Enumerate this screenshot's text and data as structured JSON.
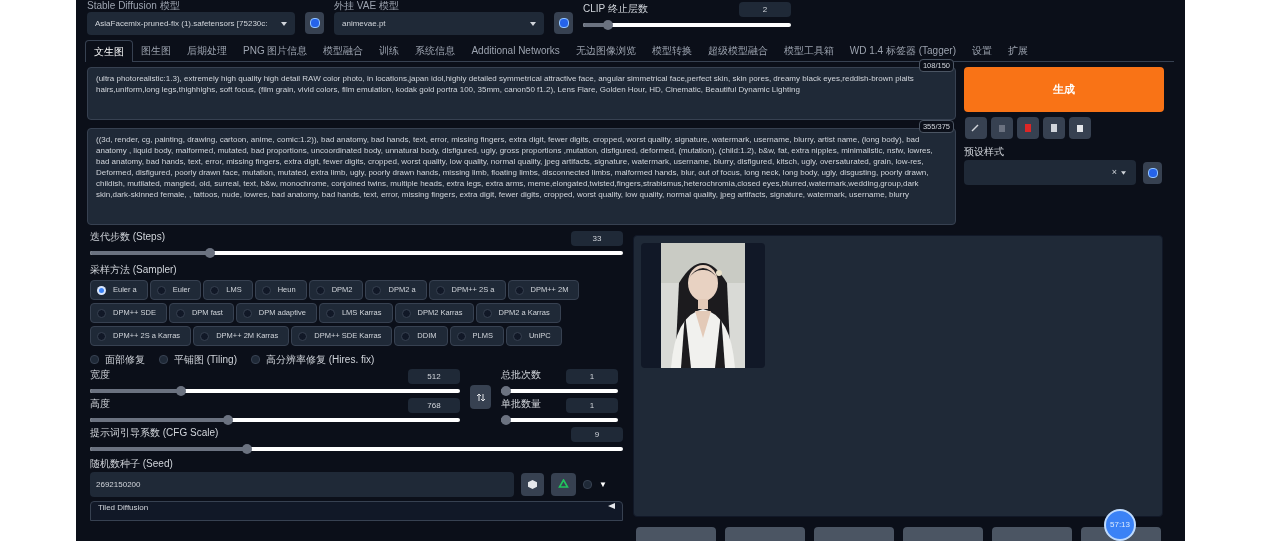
{
  "top_bar": {
    "model": {
      "label": "Stable Diffusion 模型",
      "value": "AsiaFacemix-pruned-fix (1).safetensors [75230c:"
    },
    "vae": {
      "label": "外挂 VAE 模型",
      "value": "animevae.pt"
    },
    "clip": {
      "label": "CLIP 终止层数",
      "value": "2",
      "level": 0.1
    }
  },
  "tabs": [
    {
      "label": "文生图",
      "selected": true
    },
    {
      "label": "图生图",
      "selected": false
    },
    {
      "label": "后期处理",
      "selected": false
    },
    {
      "label": "PNG 图片信息",
      "selected": false
    },
    {
      "label": "模型融合",
      "selected": false
    },
    {
      "label": "训练",
      "selected": false
    },
    {
      "label": "系统信息",
      "selected": false
    },
    {
      "label": "Additional Networks",
      "selected": false
    },
    {
      "label": "无边图像浏览",
      "selected": false
    },
    {
      "label": "模型转换",
      "selected": false
    },
    {
      "label": "超级模型融合",
      "selected": false
    },
    {
      "label": "模型工具箱",
      "selected": false
    },
    {
      "label": "WD 1.4 标签器 (Tagger)",
      "selected": false
    },
    {
      "label": "设置",
      "selected": false
    },
    {
      "label": "扩展",
      "selected": false
    }
  ],
  "prompt": {
    "value": "(ultra photorealistic:1.3), extremely high quality high detail RAW color photo, in locations,japan idol,highly detailed symmetrical attractive face, angular simmetrical face,perfect skin, skin pores, dreamy black eyes,reddish-brown plaits hairs,uniform,long legs,thighhighs,  soft focus, (film grain, vivid colors, film emulation, kodak gold portra 100, 35mm, canon50 f1.2), Lens Flare, Golden Hour, HD, Cinematic, Beautiful Dynamic Lighting",
    "counter": "108/150"
  },
  "negative_prompt": {
    "value": "((3d, render, cg, painting, drawing, cartoon, anime, comic:1.2)), bad anatomy, bad hands, text, error, missing fingers, extra digit, fewer digits, cropped, worst quality, signature, watermark, username, blurry, artist name, (long body), bad anatomy , liquid body, malformed, mutated, bad proportions, uncoordinated body, unnatural body, disfigured, ugly, gross proportions ,mutation, disfigured, deformed, (mutation), (child:1.2), b&w, fat, extra nipples, minimalistic, nsfw, lowres, bad anatomy, bad hands, text, error, missing fingers, extra digit, fewer digits, cropped, worst quality, low quality, normal quality, jpeg artifacts, signature, watermark, username, blurry, disfigured, kitsch, ugly, oversaturated, grain, low-res, Deformed, disfigured, poorly drawn face, mutation, mutated, extra limb, ugly, poorly drawn hands, missing limb, floating limbs, disconnected limbs, malformed hands, blur, out of focus, long neck, long body, ugly, disgusting, poorly drawn, childish, mutilated, mangled, old, surreal, text, b&w, monochrome, conjoined twins, multiple heads, extra legs, extra arms, meme,elongated,twisted,fingers,strabismus,heterochromia,closed eyes,blurred,watermark,wedding,group,dark skin,dark-skinned female, , tattoos, nude, lowres, bad anatomy, bad hands, text, error, missing fingers, extra digit, fewer digits, cropped, worst quality, low quality, normal quality, jpeg artifacts, signature, watermark, username, blurry",
    "counter": "355/375"
  },
  "generate_button": "生成",
  "styles": {
    "label": "预设样式",
    "clear": "×"
  },
  "steps": {
    "label": "迭代步数 (Steps)",
    "value": "33",
    "level": 0.22
  },
  "sampler": {
    "label": "采样方法 (Sampler)",
    "options": [
      {
        "label": "Euler a",
        "selected": true
      },
      {
        "label": "Euler",
        "selected": false
      },
      {
        "label": "LMS",
        "selected": false
      },
      {
        "label": "Heun",
        "selected": false
      },
      {
        "label": "DPM2",
        "selected": false
      },
      {
        "label": "DPM2 a",
        "selected": false
      },
      {
        "label": "DPM++ 2S a",
        "selected": false
      },
      {
        "label": "DPM++ 2M",
        "selected": false
      },
      {
        "label": "DPM++ SDE",
        "selected": false
      },
      {
        "label": "DPM fast",
        "selected": false
      },
      {
        "label": "DPM adaptive",
        "selected": false
      },
      {
        "label": "LMS Karras",
        "selected": false
      },
      {
        "label": "DPM2 Karras",
        "selected": false
      },
      {
        "label": "DPM2 a Karras",
        "selected": false
      },
      {
        "label": "DPM++ 2S a Karras",
        "selected": false
      },
      {
        "label": "DPM++ 2M Karras",
        "selected": false
      },
      {
        "label": "DPM++ SDE Karras",
        "selected": false
      },
      {
        "label": "DDIM",
        "selected": false
      },
      {
        "label": "PLMS",
        "selected": false
      },
      {
        "label": "UniPC",
        "selected": false
      }
    ]
  },
  "checkboxes": [
    {
      "label": "面部修复",
      "checked": false
    },
    {
      "label": "平铺图 (Tiling)",
      "checked": false
    },
    {
      "label": "高分辨率修复 (Hires. fix)",
      "checked": false
    }
  ],
  "width": {
    "label": "宽度",
    "value": "512",
    "level": 0.24
  },
  "height": {
    "label": "高度",
    "value": "768",
    "level": 0.37
  },
  "batch_count": {
    "label": "总批次数",
    "value": "1",
    "level": 0
  },
  "batch_size": {
    "label": "单批数量",
    "value": "1",
    "level": 0
  },
  "cfg": {
    "label": "提示词引导系数 (CFG Scale)",
    "value": "9",
    "level": 0.29
  },
  "seed": {
    "label": "随机数种子 (Seed)",
    "value": "2692150200",
    "extra_checked": false,
    "caret": "▼"
  },
  "tiled_diffusion": {
    "label": "Tiled Diffusion",
    "expanded": false
  },
  "timer": "57:13"
}
